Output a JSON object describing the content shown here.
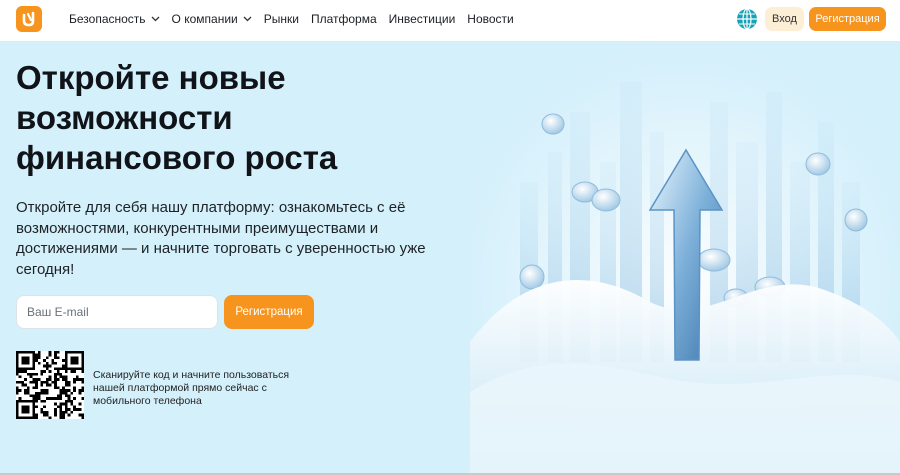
{
  "header": {
    "nav": [
      {
        "label": "Безопасность",
        "has_dropdown": true
      },
      {
        "label": "О компании",
        "has_dropdown": true
      },
      {
        "label": "Рынки",
        "has_dropdown": false
      },
      {
        "label": "Платформа",
        "has_dropdown": false
      },
      {
        "label": "Инвестиции",
        "has_dropdown": false
      },
      {
        "label": "Новости",
        "has_dropdown": false
      }
    ],
    "language_icon": "globe-icon",
    "login_label": "Вход",
    "register_label": "Регистрация"
  },
  "hero": {
    "title_lines": [
      "Откройте новые",
      "возможности",
      "финансового роста"
    ],
    "subtitle": "Откройте для себя нашу платформу: ознакомьтесь с её возможностями, конкурентными преимуществами и достижениями — и начните торговать с уверенностью уже сегодня!",
    "email_placeholder": "Ваш E-mail",
    "register_label": "Регистрация",
    "qr_text": "Сканируйте код и начните пользоваться нашей платформой прямо сейчас с мобильного телефона"
  },
  "colors": {
    "accent": "#f7941d",
    "login_bg": "#fdefd6",
    "page_bg": "#d4f0fb",
    "globe": "#16a3b7"
  }
}
